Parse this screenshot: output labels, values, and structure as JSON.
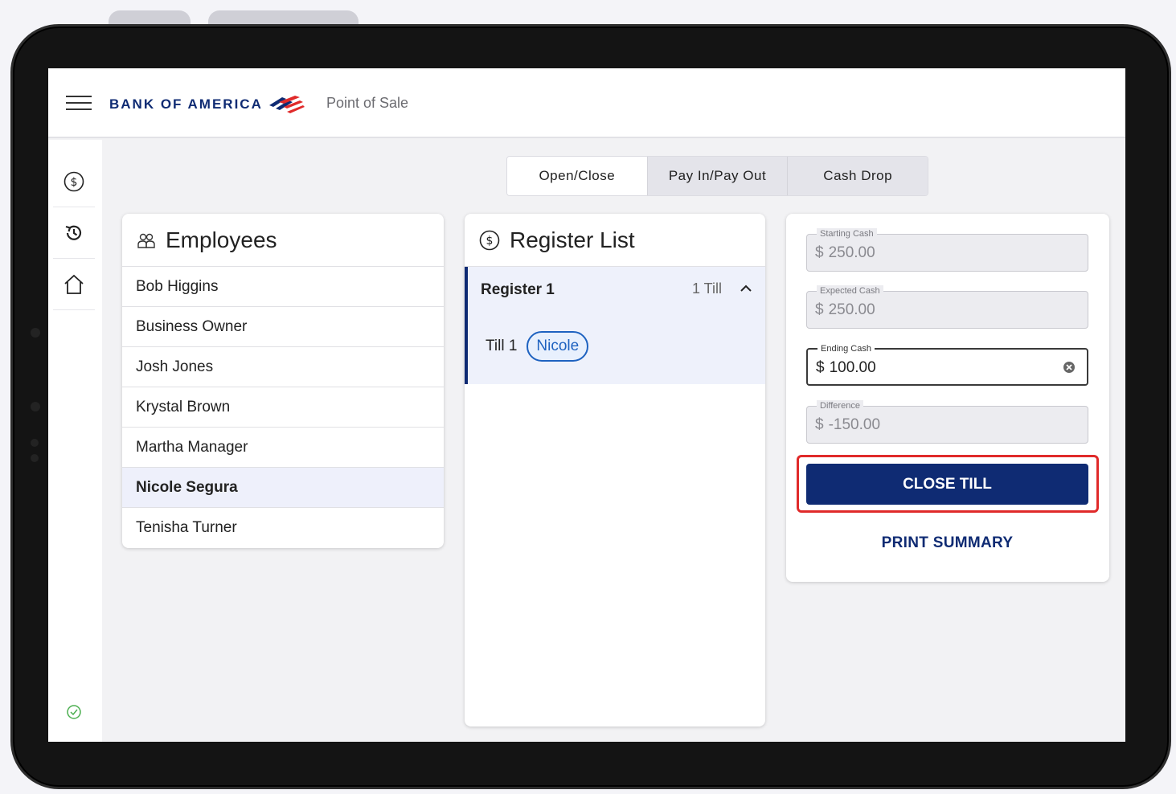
{
  "header": {
    "brand": "BANK OF AMERICA",
    "app_title": "Point of Sale"
  },
  "rail": {
    "items": [
      {
        "icon": "dollar-circle-icon"
      },
      {
        "icon": "history-icon"
      },
      {
        "icon": "home-icon"
      }
    ],
    "status_icon": "check-circle-icon"
  },
  "tabs": [
    {
      "label": "Open/Close",
      "active": true
    },
    {
      "label": "Pay In/Pay Out",
      "active": false
    },
    {
      "label": "Cash Drop",
      "active": false
    }
  ],
  "employees": {
    "title": "Employees",
    "items": [
      {
        "name": "Bob Higgins"
      },
      {
        "name": "Business Owner"
      },
      {
        "name": "Josh Jones"
      },
      {
        "name": "Krystal Brown"
      },
      {
        "name": "Martha Manager"
      },
      {
        "name": "Nicole Segura",
        "selected": true
      },
      {
        "name": "Tenisha Turner"
      }
    ]
  },
  "registers": {
    "title": "Register List",
    "groups": [
      {
        "name": "Register 1",
        "count": "1 Till",
        "tills": [
          {
            "label": "Till 1",
            "assignee": "Nicole"
          }
        ]
      }
    ]
  },
  "form": {
    "currency": "$",
    "starting_cash": {
      "label": "Starting Cash",
      "value": "250.00"
    },
    "expected_cash": {
      "label": "Expected Cash",
      "value": "250.00"
    },
    "ending_cash": {
      "label": "Ending Cash",
      "value": "100.00"
    },
    "difference": {
      "label": "Difference",
      "value": "-150.00"
    },
    "close_till_label": "CLOSE TILL",
    "print_summary_label": "PRINT SUMMARY"
  },
  "colors": {
    "brand_navy": "#0f2b73",
    "brand_red": "#e02a2a",
    "chip_blue": "#1e62c0",
    "status_green": "#4caf50"
  }
}
